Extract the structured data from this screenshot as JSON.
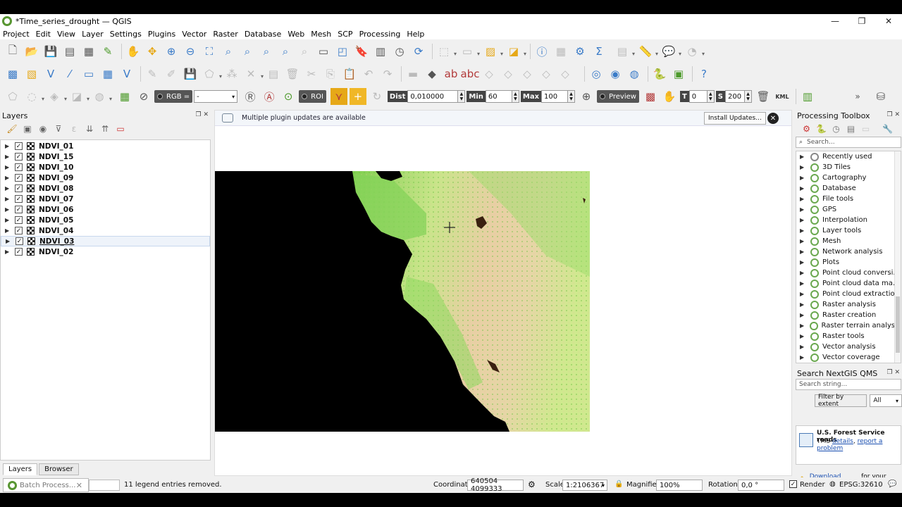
{
  "window": {
    "title": "*Time_series_drought — QGIS",
    "minimize": "—",
    "restore": "❐",
    "close": "✕"
  },
  "menu": [
    "Project",
    "Edit",
    "View",
    "Layer",
    "Settings",
    "Plugins",
    "Vector",
    "Raster",
    "Database",
    "Web",
    "Mesh",
    "SCP",
    "Processing",
    "Help"
  ],
  "scp_toolbar": {
    "rgb_label": "RGB =",
    "rgb_value": "-",
    "roi_label": "ROI",
    "dist_label": "Dist",
    "dist_value": "0,010000",
    "min_label": "Min",
    "min_value": "60",
    "max_label": "Max",
    "max_value": "100",
    "preview_label": "Preview",
    "t_label": "T",
    "t_value": "0",
    "s_label": "S",
    "s_value": "200",
    "kml_label": "KML",
    "more": "»"
  },
  "layers_panel": {
    "title": "Layers",
    "layers": [
      {
        "name": "NDVI_01",
        "checked": true
      },
      {
        "name": "NDVI_15",
        "checked": true
      },
      {
        "name": "NDVI_10",
        "checked": true
      },
      {
        "name": "NDVI_09",
        "checked": true
      },
      {
        "name": "NDVI_08",
        "checked": true
      },
      {
        "name": "NDVI_07",
        "checked": true
      },
      {
        "name": "NDVI_06",
        "checked": true
      },
      {
        "name": "NDVI_05",
        "checked": true
      },
      {
        "name": "NDVI_04",
        "checked": true
      },
      {
        "name": "NDVI_03",
        "checked": true,
        "selected": true
      },
      {
        "name": "NDVI_02",
        "checked": true
      }
    ],
    "tabs": [
      "Layers",
      "Browser"
    ],
    "active_tab": "Layers"
  },
  "message_bar": {
    "text": "Multiple plugin updates are available",
    "button": "Install Updates..."
  },
  "map": {
    "colors": {
      "nodata": "#000000",
      "low": "#e8cfa4",
      "mid": "#e6f0a0",
      "high": "#7fcf4f"
    }
  },
  "processing": {
    "title": "Processing Toolbox",
    "search_placeholder": "Search...",
    "items": [
      "Recently used",
      "3D Tiles",
      "Cartography",
      "Database",
      "File tools",
      "GPS",
      "Interpolation",
      "Layer tools",
      "Mesh",
      "Network analysis",
      "Plots",
      "Point cloud conversi...",
      "Point cloud data ma...",
      "Point cloud extraction",
      "Raster analysis",
      "Raster creation",
      "Raster terrain analysis",
      "Raster tools",
      "Vector analysis",
      "Vector coverage"
    ]
  },
  "qms": {
    "title": "Search NextGIS QMS",
    "search_placeholder": "Search string...",
    "filter_button": "Filter by extent",
    "filter_value": "All",
    "result_title": "U.S. Forest Service roads",
    "result_type": "TMS",
    "result_details": "details",
    "result_report": "report a problem",
    "download_link": "Download geodata",
    "download_suffix": "for your project"
  },
  "status": {
    "locator_placeholder": "Batch Process...",
    "message": "11 legend entries removed.",
    "coordinate_label": "Coordinate",
    "coordinate_value": "640504  4099333",
    "scale_label": "Scale",
    "scale_value": "1:2106367",
    "magnifier_label": "Magnifier",
    "magnifier_value": "100%",
    "rotation_label": "Rotation",
    "rotation_value": "0,0 °",
    "render_label": "Render",
    "crs": "EPSG:32610"
  }
}
